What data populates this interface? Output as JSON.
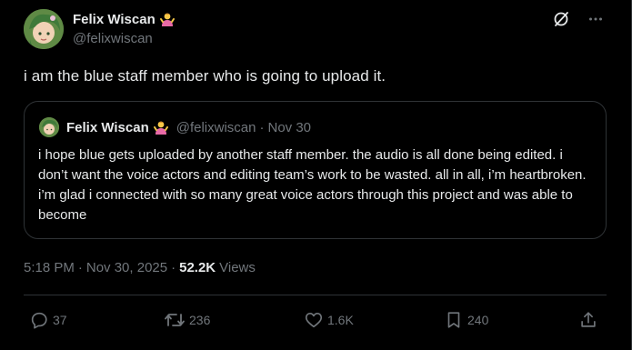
{
  "author": {
    "name": "Felix Wiscan",
    "handle": "@felixwiscan",
    "badge_emoji": "🤷‍♀️"
  },
  "post": {
    "text": "i am the blue staff member who is going to upload it.",
    "time": "5:18 PM",
    "date": "Nov 30, 2025",
    "views_count": "52.2K",
    "views_label": "Views"
  },
  "quoted": {
    "name": "Felix Wiscan",
    "handle": "@felixwiscan",
    "date": "Nov 30",
    "text": "i hope blue gets uploaded by another staff member. the audio is all done being edited. i don’t want the voice actors and editing team’s work to be wasted. all in all, i’m heartbroken. i’m glad i connected with so many great voice actors through this project and was able to become"
  },
  "actions": {
    "replies": "37",
    "reposts": "236",
    "likes": "1.6K",
    "bookmarks": "240"
  },
  "icons": {
    "grok": "grok-icon",
    "more": "more-icon",
    "reply": "reply-icon",
    "repost": "repost-icon",
    "like": "like-icon",
    "bookmark": "bookmark-icon",
    "share": "share-icon"
  },
  "colors": {
    "background": "#000000",
    "text": "#e7e9ea",
    "secondary": "#71767b",
    "border": "#2f3336"
  }
}
